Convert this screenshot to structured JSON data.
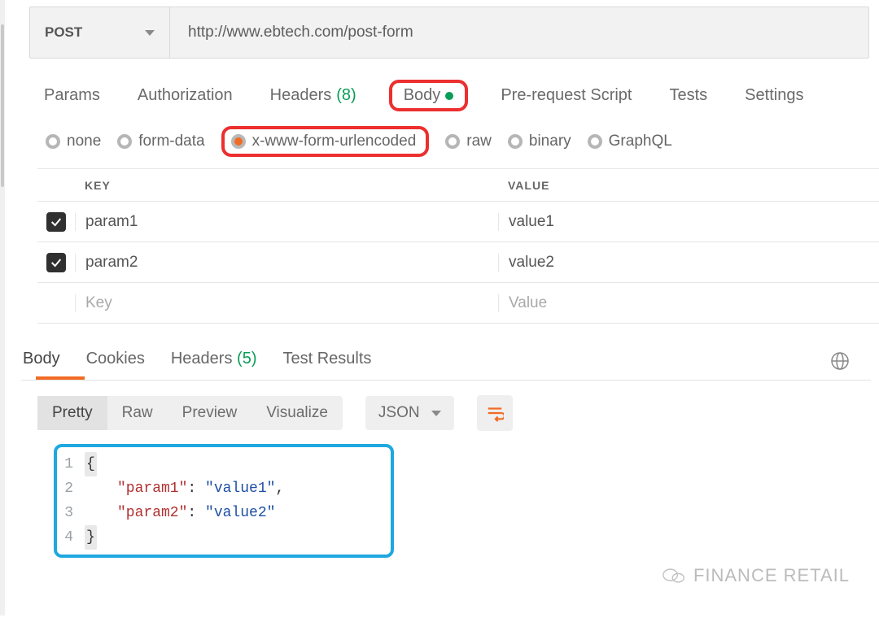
{
  "request": {
    "method": "POST",
    "url": "http://www.ebtech.com/post-form",
    "tabs": {
      "params": "Params",
      "authorization": "Authorization",
      "headers_label": "Headers",
      "headers_count": "(8)",
      "body": "Body",
      "prerequest": "Pre-request Script",
      "tests": "Tests",
      "settings": "Settings"
    },
    "body_types": {
      "none": "none",
      "formdata": "form-data",
      "urlencoded": "x-www-form-urlencoded",
      "raw": "raw",
      "binary": "binary",
      "graphql": "GraphQL"
    }
  },
  "param_table": {
    "header_key": "KEY",
    "header_value": "VALUE",
    "rows": [
      {
        "checked": true,
        "key": "param1",
        "value": "value1"
      },
      {
        "checked": true,
        "key": "param2",
        "value": "value2"
      }
    ],
    "placeholder_key": "Key",
    "placeholder_value": "Value"
  },
  "response": {
    "tabs": {
      "body": "Body",
      "cookies": "Cookies",
      "headers_label": "Headers",
      "headers_count": "(5)",
      "test_results": "Test Results"
    },
    "views": {
      "pretty": "Pretty",
      "raw": "Raw",
      "preview": "Preview",
      "visualize": "Visualize"
    },
    "type": "JSON",
    "code": {
      "l1": "{",
      "l2_key": "\"param1\"",
      "l2_val": "\"value1\"",
      "l3_key": "\"param2\"",
      "l3_val": "\"value2\"",
      "l4": "}"
    },
    "line_numbers": [
      "1",
      "2",
      "3",
      "4"
    ]
  },
  "watermark": "FINANCE RETAIL"
}
